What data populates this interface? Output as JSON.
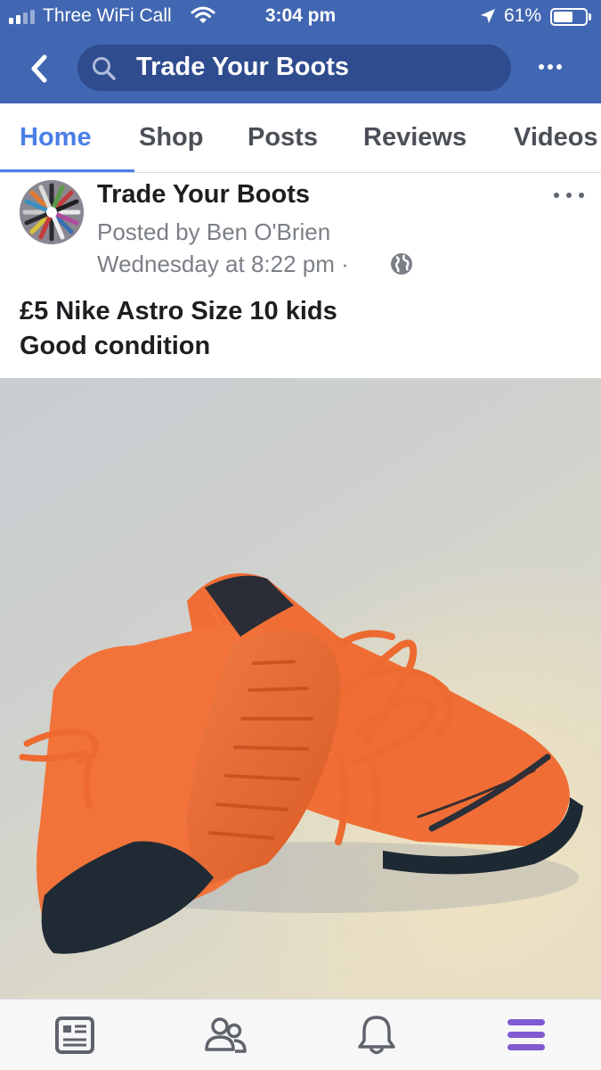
{
  "status_bar": {
    "carrier": "Three WiFi Call",
    "time": "3:04 pm",
    "battery": "61%",
    "battery_level": 0.61,
    "signal_bars": 2
  },
  "header": {
    "search_query": "Trade Your Boots",
    "icons": [
      "back-chevron-icon",
      "search-icon",
      "more-icon"
    ]
  },
  "tabs": [
    {
      "label": "Home",
      "active": true
    },
    {
      "label": "Shop",
      "active": false
    },
    {
      "label": "Posts",
      "active": false
    },
    {
      "label": "Reviews",
      "active": false
    },
    {
      "label": "Videos",
      "active": false
    }
  ],
  "post": {
    "page_name": "Trade Your Boots",
    "posted_by": "Posted by Ben O'Brien",
    "timestamp": "Wednesday at 8:22 pm ·",
    "privacy_icon": "globe-icon",
    "text_line1": "£5 Nike Astro Size 10 kids",
    "text_line2": "Good condition"
  },
  "bottom_nav": [
    {
      "icon": "news-feed-icon",
      "active": false
    },
    {
      "icon": "friends-icon",
      "active": false
    },
    {
      "icon": "notifications-bell-icon",
      "active": false
    },
    {
      "icon": "menu-icon",
      "active": true
    }
  ],
  "colors": {
    "header_blue": "#4267b2",
    "active_tab": "#4a7ee8",
    "active_nav": "#7f5ad0",
    "boot_orange": "#f0713a"
  }
}
